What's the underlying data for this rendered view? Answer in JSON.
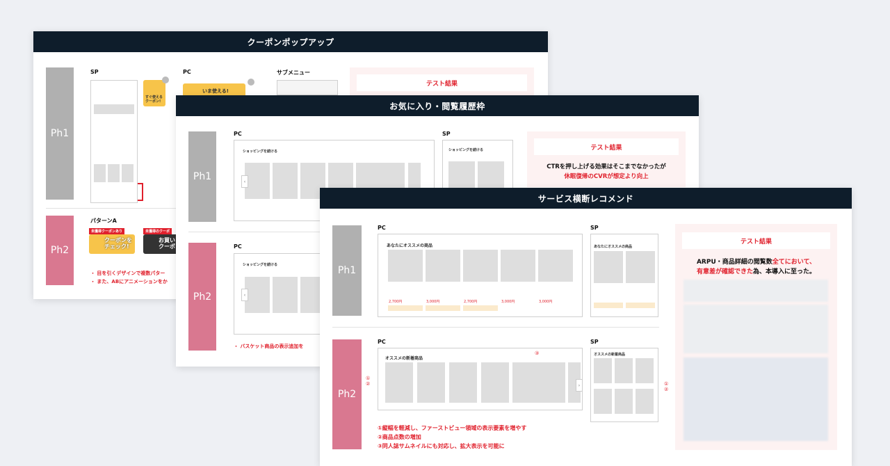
{
  "card1": {
    "title": "クーポンポップアップ",
    "ph1": "Ph1",
    "ph2": "Ph2",
    "sp_label": "SP",
    "pc_label": "PC",
    "submenu_label": "サブメニュー",
    "coupon_sp_text": "すぐ使える\nクーポン!",
    "coupon_pc_text": "いま使える!",
    "result_title": "テスト結果",
    "patternA_label": "パターンA",
    "badge1": "未獲得クーポンあり",
    "badge2": "未獲得のクーポ",
    "coupon_check": "クーポンを\nチェック!",
    "coupon_check2": "お買い\nクーポ",
    "notes": [
      "・ 目を引くデザインで複数パター",
      "・ また、ABにアニメーションをか"
    ]
  },
  "card2": {
    "title": "お気に入り・閲覧履歴枠",
    "ph1": "Ph1",
    "ph2": "Ph2",
    "pc_label": "PC",
    "sp_label": "SP",
    "pc_label2": "PC",
    "shopping_title": "ショッピングを続ける",
    "result_title": "テスト結果",
    "result_line1": "CTRを押し上げる効果はそこまでなかったが",
    "result_line2": "休眠復帰のCVRが想定より向上",
    "note": "・ バスケット商品の表示追加を"
  },
  "card3": {
    "title": "サービス横断レコメンド",
    "ph1": "Ph1",
    "ph2": "Ph2",
    "pc_label": "PC",
    "sp_label": "SP",
    "pc_label2": "PC",
    "sp_label2": "SP",
    "reco_title": "あなたにオススメの商品",
    "new_title": "オススメの新着商品",
    "price_items": [
      "2,700円",
      "3,000円",
      "2,700円",
      "3,000円",
      "3,000円"
    ],
    "result_title": "テスト結果",
    "result_line1_a": "ARPU・商品詳細の閲覧数",
    "result_line1_b": "全てにおいて、",
    "result_line2_a": "有意差が確認できた",
    "result_line2_b": "為、本導入に至った。",
    "mark3": "③",
    "mark12": "①\n②",
    "notes": [
      "①縦幅を軽減し、ファーストビュー領域の表示要素を増やす",
      "②商品点数の増加",
      "③同人誌サムネイルにも対応し、拡大表示を可能に"
    ]
  }
}
